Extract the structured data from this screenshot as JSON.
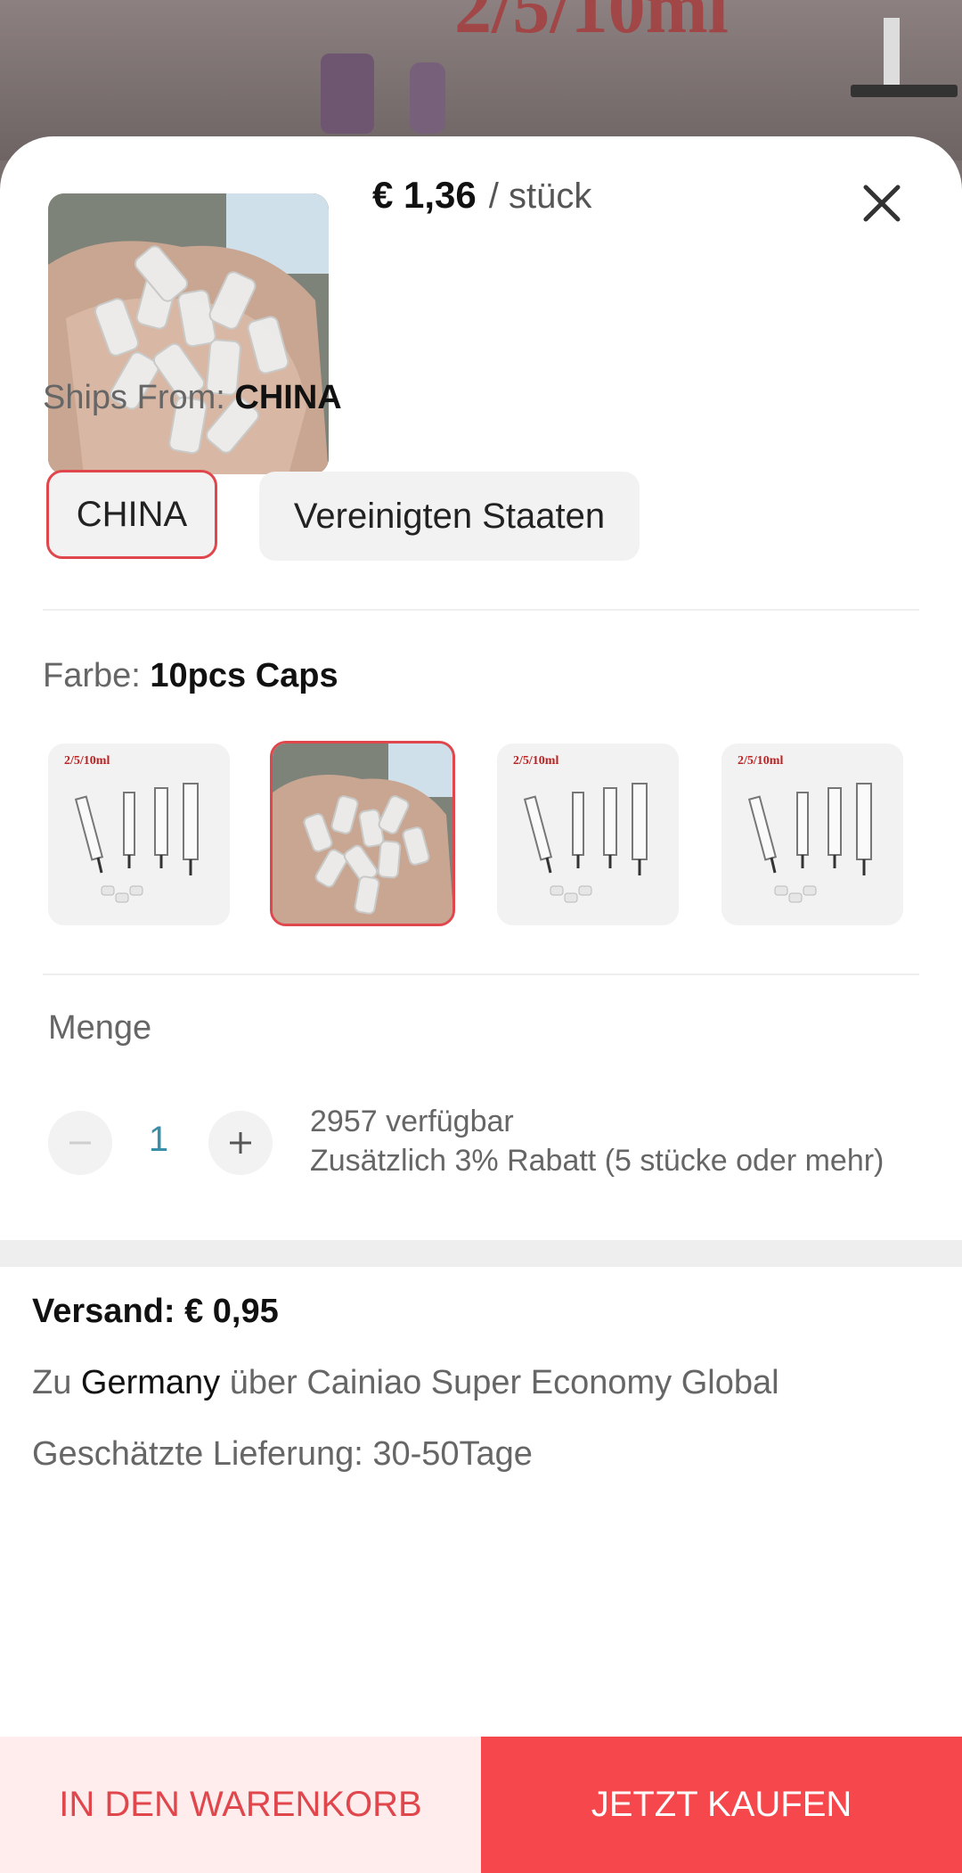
{
  "header": {
    "price": "€ 1,36",
    "unit": "/ stück",
    "close_icon": "close-icon"
  },
  "ships_from": {
    "label": "Ships From: ",
    "selected_value": "CHINA",
    "options": [
      "CHINA",
      "Vereinigten Staaten"
    ]
  },
  "color": {
    "label": "Farbe: ",
    "selected_value": "10pcs Caps",
    "thumb_tag": "2/5/10ml"
  },
  "quantity": {
    "label": "Menge",
    "value": "1",
    "minus_icon": "minus-icon",
    "plus_icon": "plus-icon",
    "available": "2957 verfügbar",
    "discount": "Zusätzlich 3% Rabatt (5 stücke oder mehr)"
  },
  "shipping": {
    "cost": "Versand: € 0,95",
    "route_prefix": "Zu ",
    "route_country": "Germany",
    "route_suffix": " über Cainiao Super Economy Global",
    "eta": "Geschätzte Lieferung: 30-50Tage"
  },
  "actions": {
    "add_to_cart": "IN DEN WARENKORB",
    "buy_now": "JETZT KAUFEN"
  },
  "colors": {
    "accent": "#e0474d",
    "buy_button": "#f6484c",
    "cart_button_bg": "#ffecec",
    "quantity_value": "#3a8fa8"
  }
}
